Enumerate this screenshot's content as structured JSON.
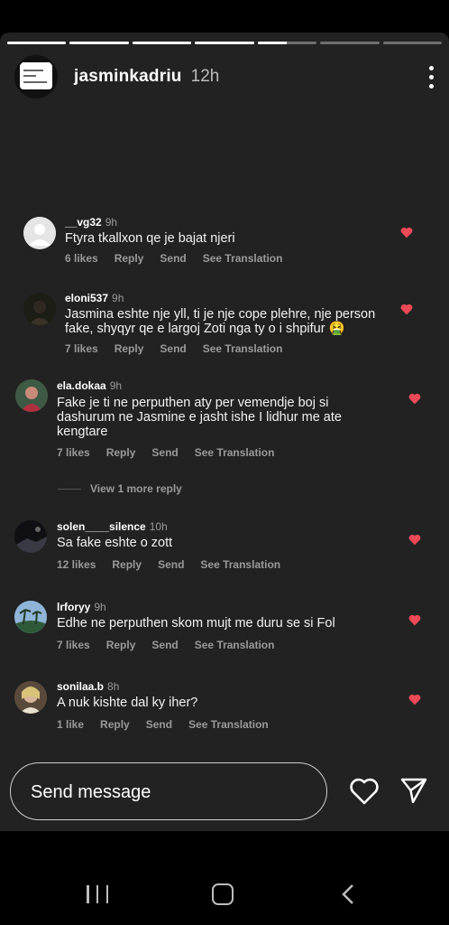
{
  "story": {
    "progress": [
      1,
      1,
      1,
      1,
      0.5,
      0,
      0
    ],
    "username": "jasminkadriu",
    "time": "12h"
  },
  "comments": [
    {
      "user": "__vg32",
      "time": "9h",
      "text": [
        "Ftyra tkallxon qe je bajat njeri"
      ],
      "likes": "6 likes",
      "reply": "Reply",
      "send": "Send",
      "translate": "See Translation"
    },
    {
      "user": "eloni537",
      "time": "9h",
      "text": [
        "Jasmina eshte nje yll, ti je nje cope plehre, nje person",
        "fake, shyqyr qe e largoj Zoti nga ty o i shpifur 🤮"
      ],
      "likes": "7 likes",
      "reply": "Reply",
      "send": "Send",
      "translate": "See Translation"
    },
    {
      "user": "ela.dokaa",
      "time": "9h",
      "text": [
        "Fake je ti ne perputhen aty per vemendje boj si",
        "dashurum ne Jasmine e jasht ishe I lidhur me ate",
        "kengtare"
      ],
      "likes": "7 likes",
      "reply": "Reply",
      "send": "Send",
      "translate": "See Translation"
    },
    {
      "user": "solen____silence",
      "time": "10h",
      "text": [
        "Sa fake eshte o zott"
      ],
      "likes": "12 likes",
      "reply": "Reply",
      "send": "Send",
      "translate": "See Translation"
    },
    {
      "user": "lrforyy",
      "time": "9h",
      "text": [
        "Edhe ne perputhen skom mujt me duru se si Fol"
      ],
      "likes": "7 likes",
      "reply": "Reply",
      "send": "Send",
      "translate": "See Translation"
    },
    {
      "user": "sonilaa.b",
      "time": "8h",
      "text": [
        "A nuk kishte dal ky iher?"
      ],
      "likes": "1 like",
      "reply": "Reply",
      "send": "Send",
      "translate": "See Translation"
    }
  ],
  "view_more": "View 1 more reply",
  "footer": {
    "placeholder": "Send message"
  },
  "colors": {
    "heart": "#ed4956",
    "background": "#222222"
  }
}
